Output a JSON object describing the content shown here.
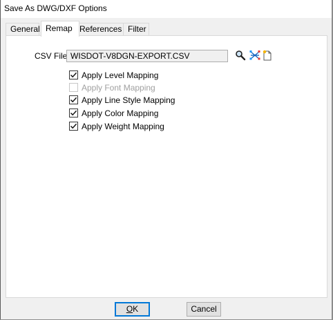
{
  "window": {
    "title": "Save As DWG/DXF Options"
  },
  "tabs": [
    {
      "label": "General",
      "active": false
    },
    {
      "label": "Remap",
      "active": true
    },
    {
      "label": "References",
      "active": false
    },
    {
      "label": "Filter",
      "active": false
    }
  ],
  "remap": {
    "csv_label": "CSV File",
    "csv_value": "WISDOT-V8DGN-EXPORT.CSV",
    "icons": [
      "browse-search-icon",
      "mapping-tool-icon",
      "new-file-icon"
    ],
    "options": [
      {
        "label": "Apply Level Mapping",
        "checked": true,
        "enabled": true
      },
      {
        "label": "Apply Font Mapping",
        "checked": false,
        "enabled": false
      },
      {
        "label": "Apply Line Style Mapping",
        "checked": true,
        "enabled": true
      },
      {
        "label": "Apply Color Mapping",
        "checked": true,
        "enabled": true
      },
      {
        "label": "Apply Weight Mapping",
        "checked": true,
        "enabled": true
      }
    ]
  },
  "buttons": {
    "ok_mnemonic": "O",
    "ok_rest": "K",
    "cancel": "Cancel"
  },
  "colors": {
    "accent": "#0078d7",
    "disabled_text": "#a0a0a0"
  }
}
